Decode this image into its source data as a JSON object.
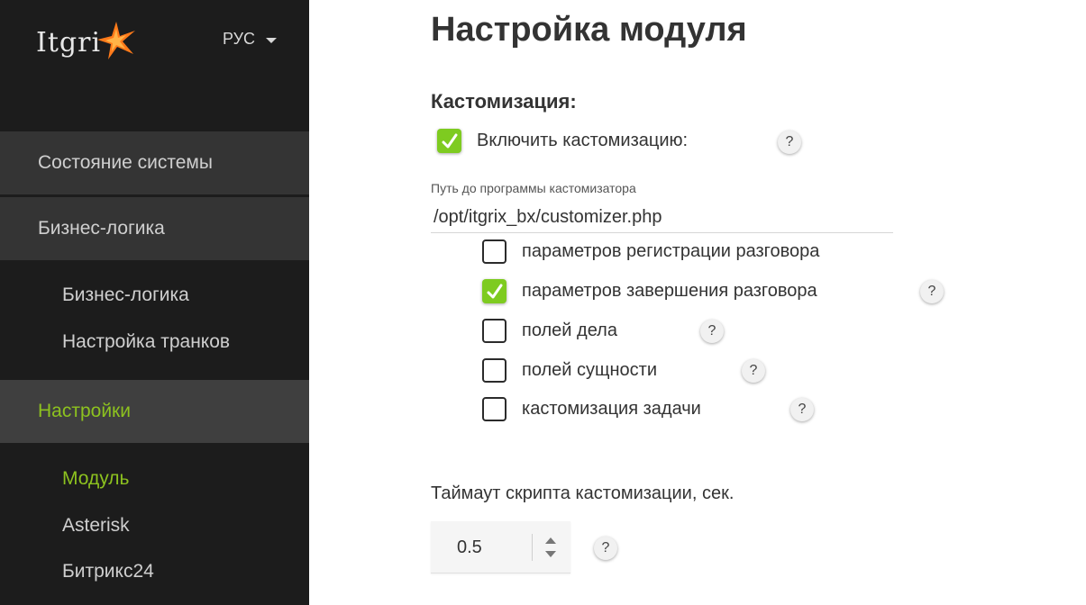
{
  "sidebar": {
    "logo_text": "Itgri",
    "language": "РУС",
    "sections": [
      {
        "label": "Состояние системы"
      },
      {
        "label": "Бизнес-логика"
      },
      {
        "label": "Настройки"
      }
    ],
    "business_items": [
      {
        "label": "Бизнес-логика"
      },
      {
        "label": "Настройка транков"
      }
    ],
    "settings_items": [
      {
        "label": "Модуль"
      },
      {
        "label": "Asterisk"
      },
      {
        "label": "Битрикс24"
      }
    ]
  },
  "main": {
    "title": "Настройка модуля",
    "section_title": "Кастомизация:",
    "enable_customization": {
      "label": "Включить кастомизацию:",
      "checked": true
    },
    "path_field": {
      "label": "Путь до программы кастомизатора",
      "value": "/opt/itgrix_bx/customizer.php"
    },
    "options": [
      {
        "label": "параметров регистрации разговора",
        "checked": false
      },
      {
        "label": "параметров завершения разговора",
        "checked": true
      },
      {
        "label": "полей дела",
        "checked": false
      },
      {
        "label": "полей сущности",
        "checked": false
      },
      {
        "label": "кастомизация задачи",
        "checked": false
      }
    ],
    "timeout": {
      "label": "Таймаут скрипта кастомизации, сек.",
      "value": "0.5"
    },
    "help_symbol": "?"
  },
  "colors": {
    "accent": "#8dc21f",
    "checkbox_checked": "#7ecb20",
    "sidebar_bg": "#1c1c1c",
    "section_bg": "#343434",
    "active_section_bg": "#3f3f3f"
  }
}
